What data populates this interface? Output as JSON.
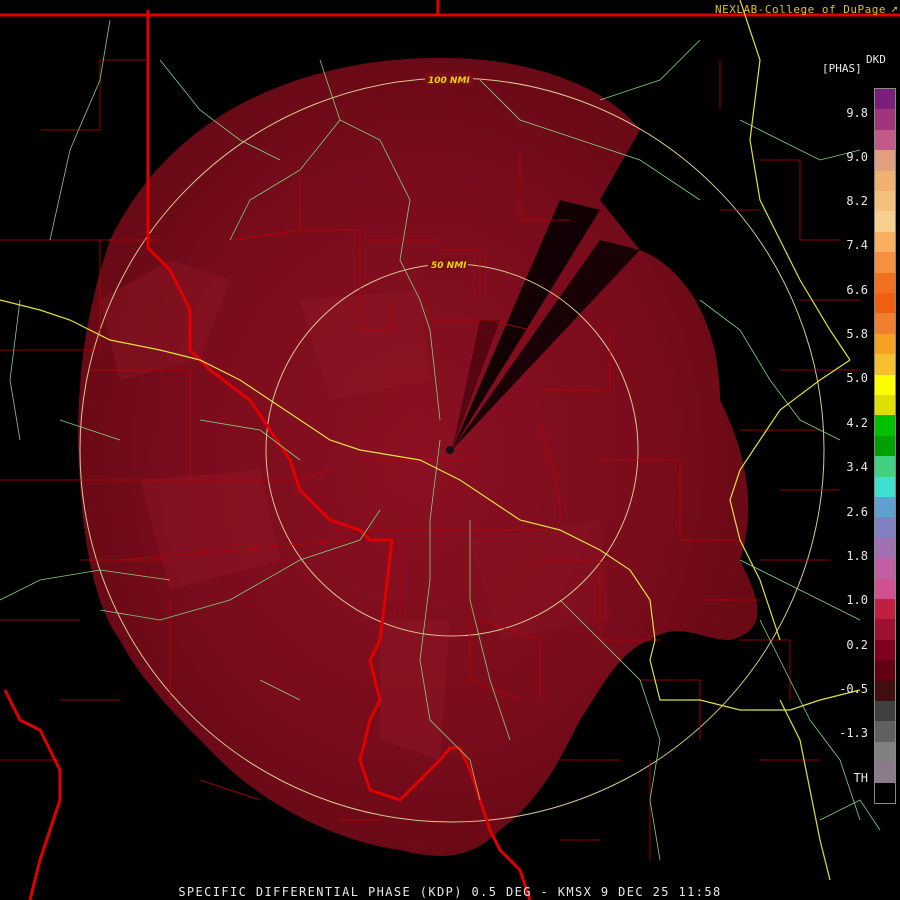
{
  "credit": "NEXLAB-College of DuPage",
  "units": {
    "top": "DKD",
    "sub": "[PHAS]"
  },
  "footer": "SPECIFIC DIFFERENTIAL PHASE (KDP) 0.5 DEG - KMSX 9 DEC 25 11:58",
  "rings": [
    {
      "label": "100 NMI",
      "range_nmi": 100
    },
    {
      "label": "50 NMI",
      "range_nmi": 50
    }
  ],
  "legend": {
    "labels": [
      "9.8",
      "9.0",
      "8.2",
      "7.4",
      "6.6",
      "5.8",
      "5.0",
      "4.2",
      "3.4",
      "2.6",
      "1.8",
      "1.0",
      "0.2",
      "-0.5",
      "-1.3",
      "TH"
    ],
    "colors": [
      "#7a1f7a",
      "#a0357a",
      "#c05a8a",
      "#e0a080",
      "#f0b070",
      "#f4c080",
      "#f5d090",
      "#f8b060",
      "#f59040",
      "#f07020",
      "#ee6010",
      "#f08030",
      "#f5a020",
      "#f5c030",
      "#ffff00",
      "#e0e000",
      "#00c000",
      "#00a000",
      "#40d080",
      "#40e0d0",
      "#60a0d0",
      "#8080c0",
      "#a070b0",
      "#c060a0",
      "#d05090",
      "#c02040",
      "#a01030",
      "#800020",
      "#600010",
      "#401010",
      "#404040",
      "#606060",
      "#808080",
      "#8a7a8a",
      "#000000"
    ],
    "accent_colors": {
      "data_field": "#7a0a14",
      "state_lines": "#e00000",
      "county_lines": "#c00000",
      "highways": "#e0e040",
      "rivers": "#80d080",
      "rings": "#d8c890"
    }
  }
}
